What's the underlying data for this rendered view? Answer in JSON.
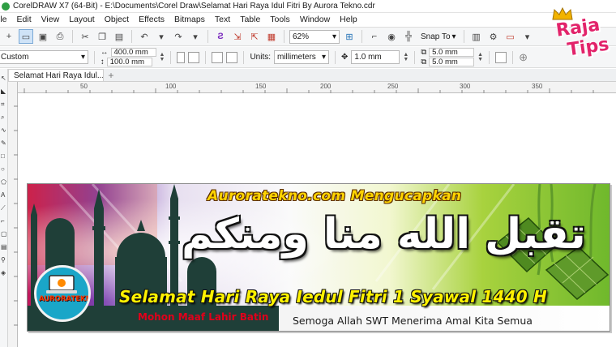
{
  "window": {
    "title": "CorelDRAW X7 (64-Bit) - E:\\Documents\\Corel Draw\\Selamat Hari Raya Idul Fitri By Aurora Tekno.cdr"
  },
  "menu": [
    {
      "label": "ile"
    },
    {
      "label": "Edit"
    },
    {
      "label": "View"
    },
    {
      "label": "Layout"
    },
    {
      "label": "Object"
    },
    {
      "label": "Effects"
    },
    {
      "label": "Bitmaps"
    },
    {
      "label": "Text"
    },
    {
      "label": "Table"
    },
    {
      "label": "Tools"
    },
    {
      "label": "Window"
    },
    {
      "label": "Help"
    }
  ],
  "toolbar": {
    "zoom": "62%",
    "snap_label": "Snap To"
  },
  "properties": {
    "page_preset": "Custom",
    "width": "400.0 mm",
    "height": "100.0 mm",
    "units_label": "Units:",
    "units_value": "millimeters",
    "nudge": "1.0 mm",
    "dup_x": "5.0 mm",
    "dup_y": "5.0 mm"
  },
  "tabs": {
    "document": "Selamat Hari Raya Idul..."
  },
  "ruler": {
    "labels": [
      "50",
      "100",
      "150",
      "200",
      "250",
      "300",
      "350"
    ]
  },
  "banner": {
    "heading": "Auroratekno.com Mengucapkan",
    "arabic": "تقبل الله منا ومنكم",
    "greeting": "Selamat Hari Raya Iedul Fitri 1 Syawal 1440 H",
    "apology": "Mohon Maaf Lahir Batin",
    "prayer": "Semoga Allah SWT Menerima Amal Kita Semua",
    "logo_text": "AURORATEKNO"
  },
  "watermark": {
    "line1": "Raja",
    "line2": "Tips"
  },
  "colors": {
    "heading_yellow": "#ffd400",
    "greeting_yellow": "#fff200",
    "apology_red": "#e0001b",
    "ketupat_green": "#5f9a2a",
    "watermark_pink": "#e2236a"
  }
}
